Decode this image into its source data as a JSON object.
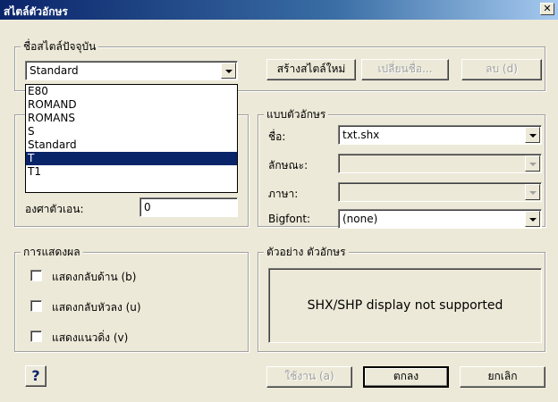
{
  "window": {
    "title": "สไตล์ตัวอักษร",
    "close_glyph": "✕"
  },
  "current_style": {
    "group_label": "ชื่อสไตล์ปัจจุบัน",
    "selected": "Standard",
    "new_button": "สร้างสไตล์ใหม่",
    "rename_button": "เปลี่ยนชื่อ...",
    "delete_button": "ลบ (d)",
    "dropdown_items": [
      "E80",
      "ROMAND",
      "ROMANS",
      "S",
      "Standard",
      "T",
      "T1"
    ],
    "highlighted_item": "T"
  },
  "size_effects": {
    "oblique_label": "องศาตัวเอน:",
    "oblique_value": "0"
  },
  "font": {
    "group_label": "แบบตัวอักษร",
    "name_label": "ชื่อ:",
    "name_value": "txt.shx",
    "style_label": "ลักษณะ:",
    "language_label": "ภาษา:",
    "bigfont_label": "Bigfont:",
    "bigfont_value": "(none)"
  },
  "effects": {
    "group_label": "การแสดงผล",
    "backwards": "แสดงกลับด้าน (b)",
    "upside_down": "แสดงกลับหัวลง (u)",
    "vertical": "แสดงแนวดิ่ง (v)"
  },
  "preview": {
    "group_label": "ตัวอย่าง ตัวอักษร",
    "message": "SHX/SHP display not supported"
  },
  "footer": {
    "help_glyph": "?",
    "apply_button": "ใช้งาน (a)",
    "ok_button": "ตกลง",
    "cancel_button": "ยกเลิก"
  },
  "colors": {
    "highlight": "#0a246a",
    "face": "#ece9d8"
  }
}
